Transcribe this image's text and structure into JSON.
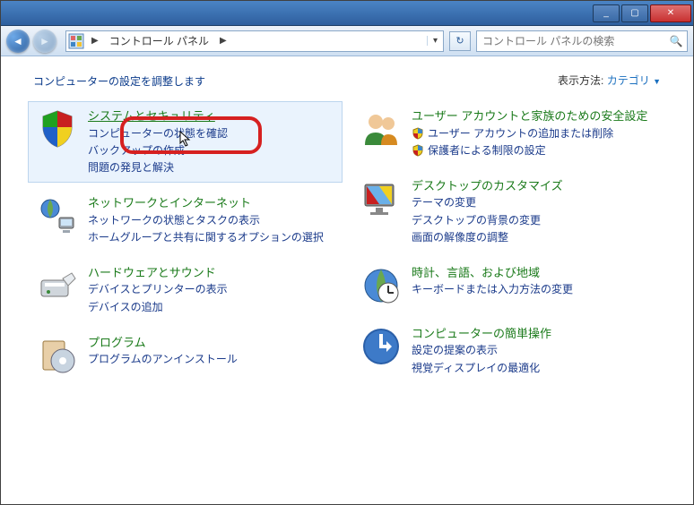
{
  "titlebar": {
    "min": "_",
    "max": "▢",
    "close": "✕"
  },
  "nav": {
    "breadcrumb": "コントロール パネル",
    "arrow": "▶",
    "refresh": "↻",
    "search_placeholder": "コントロール パネルの検索"
  },
  "header": {
    "adjust": "コンピューターの設定を調整します",
    "viewby_label": "表示方法:",
    "viewby_value": "カテゴリ",
    "dd": "▼"
  },
  "left": [
    {
      "title": "システムとセキュリティ",
      "subs": [
        "コンピューターの状態を確認",
        "バックアップの作成",
        "問題の発見と解決"
      ],
      "hl": true
    },
    {
      "title": "ネットワークとインターネット",
      "subs": [
        "ネットワークの状態とタスクの表示",
        "ホームグループと共有に関するオプションの選択"
      ]
    },
    {
      "title": "ハードウェアとサウンド",
      "subs": [
        "デバイスとプリンターの表示",
        "デバイスの追加"
      ]
    },
    {
      "title": "プログラム",
      "subs": [
        "プログラムのアンインストール"
      ]
    }
  ],
  "right": [
    {
      "title": "ユーザー アカウントと家族のための安全設定",
      "subs": [
        {
          "t": "ユーザー アカウントの追加または削除",
          "shield": true
        },
        {
          "t": "保護者による制限の設定",
          "shield": true
        }
      ]
    },
    {
      "title": "デスクトップのカスタマイズ",
      "subs": [
        {
          "t": "テーマの変更"
        },
        {
          "t": "デスクトップの背景の変更"
        },
        {
          "t": "画面の解像度の調整"
        }
      ]
    },
    {
      "title": "時計、言語、および地域",
      "subs": [
        {
          "t": "キーボードまたは入力方法の変更"
        }
      ]
    },
    {
      "title": "コンピューターの簡単操作",
      "subs": [
        {
          "t": "設定の提案の表示"
        },
        {
          "t": "視覚ディスプレイの最適化"
        }
      ]
    }
  ]
}
